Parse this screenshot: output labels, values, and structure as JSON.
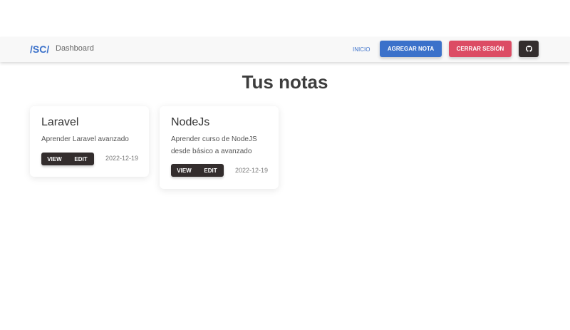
{
  "navbar": {
    "brand": "/SC/",
    "dashboard_label": "Dashboard",
    "inicio_label": "INICIO",
    "add_note_label": "AGREGAR NOTA",
    "logout_label": "CERRAR SESIÓN",
    "github_icon": "github-icon"
  },
  "main": {
    "title": "Tus notas"
  },
  "notes": [
    {
      "title": "Laravel",
      "description": "Aprender Laravel avanzado",
      "view_label": "VIEW",
      "edit_label": "EDIT",
      "date": "2022-12-19"
    },
    {
      "title": "NodeJs",
      "description": "Aprender curso de NodeJS desde básico a avanzado",
      "view_label": "VIEW",
      "edit_label": "EDIT",
      "date": "2022-12-19"
    }
  ],
  "colors": {
    "primary": "#3b71ca",
    "danger": "#dc4c64",
    "dark": "#332d2d"
  }
}
